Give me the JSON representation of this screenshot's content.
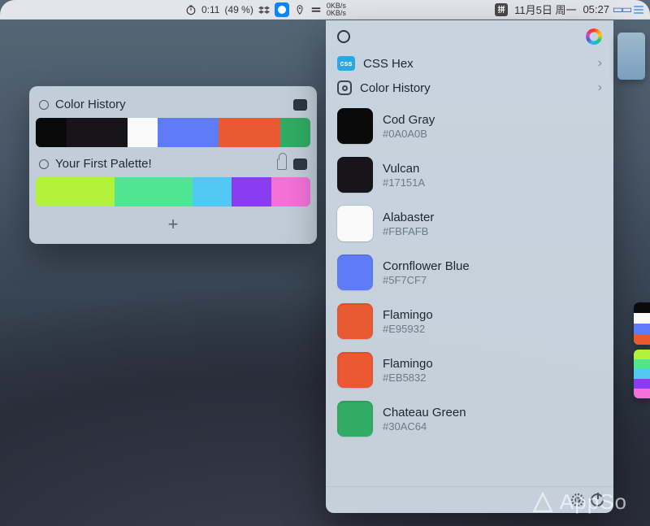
{
  "menubar": {
    "timer_label": "0:11",
    "battery_label": "(49 %)",
    "netspeed_up": "0KB/s",
    "netspeed_down": "0KB/s",
    "pinyin_label": "拼",
    "date_label": "11月5日 周一",
    "time_label": "05:27"
  },
  "palette_panel": {
    "sections": [
      {
        "title": "Color History",
        "locked": false,
        "swatches": [
          "#0A0A0B",
          "#17151A",
          "#17151A",
          "#FBFAFB",
          "#5F7CF7",
          "#5F7CF7",
          "#E95932",
          "#E95932",
          "#30AC64"
        ]
      },
      {
        "title": "Your First Palette!",
        "locked": true,
        "swatches": [
          "#B3F23A",
          "#B3F23A",
          "#4FE693",
          "#4FE693",
          "#51C9F5",
          "#8A3CF3",
          "#F471D9"
        ]
      }
    ],
    "add_label": "+"
  },
  "drop_panel": {
    "format_row": {
      "badge": "css",
      "label": "CSS Hex"
    },
    "history_row": {
      "label": "Color History"
    },
    "colors": [
      {
        "name": "Cod Gray",
        "hex": "#0A0A0B"
      },
      {
        "name": "Vulcan",
        "hex": "#17151A"
      },
      {
        "name": "Alabaster",
        "hex": "#FBFAFB"
      },
      {
        "name": "Cornflower Blue",
        "hex": "#5F7CF7"
      },
      {
        "name": "Flamingo",
        "hex": "#E95932"
      },
      {
        "name": "Flamingo",
        "hex": "#EB5832"
      },
      {
        "name": "Chateau Green",
        "hex": "#30AC64"
      }
    ]
  },
  "edge_widgets": {
    "w1": [
      "#0A0A0B",
      "#FBFAFB",
      "#5F7CF7",
      "#E95932"
    ],
    "w2": [
      "#B3F23A",
      "#4FE693",
      "#51C9F5",
      "#8A3CF3",
      "#F471D9"
    ]
  },
  "watermark": {
    "text": "AppSo"
  }
}
